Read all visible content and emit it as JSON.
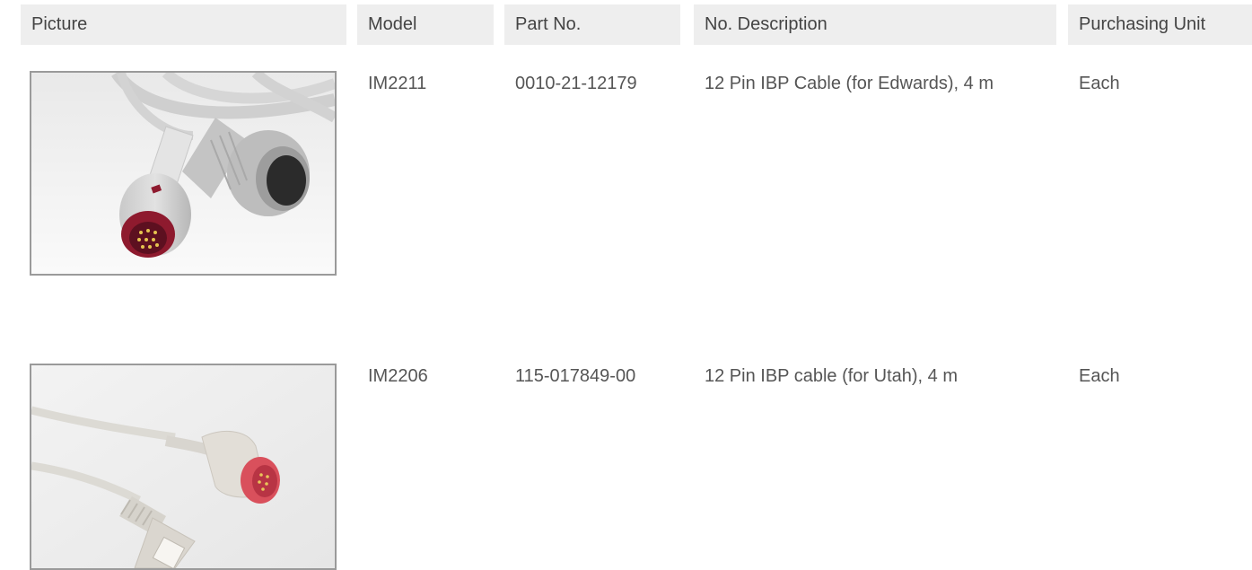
{
  "table": {
    "headers": {
      "picture": "Picture",
      "model": "Model",
      "part_no": "Part No.",
      "description": "No. Description",
      "unit": "Purchasing Unit"
    },
    "rows": [
      {
        "image_icon": "ibp-cable-edwards-photo",
        "model": "IM2211",
        "part_no": "0010-21-12179",
        "description": "12 Pin IBP Cable (for Edwards), 4 m",
        "unit": "Each"
      },
      {
        "image_icon": "ibp-cable-utah-photo",
        "model": "IM2206",
        "part_no": "115-017849-00",
        "description": "12 Pin IBP cable (for Utah), 4 m",
        "unit": "Each"
      }
    ]
  },
  "colors": {
    "header_bg": "#eeeeee",
    "text": "#555555",
    "frame_border": "#9a9a9a",
    "connector_red": "#8e1a2e",
    "connector_pink": "#d9505c"
  }
}
